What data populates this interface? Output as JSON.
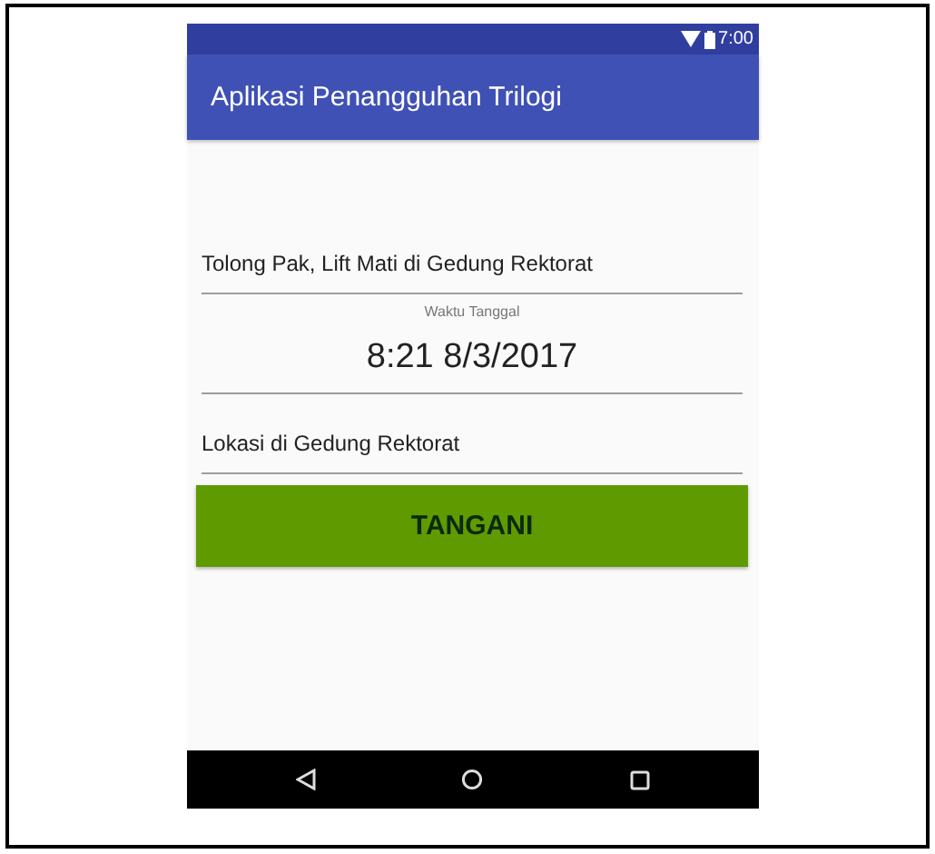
{
  "status_bar": {
    "time": "7:00"
  },
  "app_bar": {
    "title": "Aplikasi Penangguhan Trilogi"
  },
  "fields": [
    {
      "kind": "text",
      "value": "Tolong Pak, Lift Mati di Gedung Rektorat"
    },
    {
      "kind": "labeled",
      "label": "Waktu Tanggal",
      "value": "8:21 8/3/2017"
    },
    {
      "kind": "text",
      "value": "Lokasi di Gedung Rektorat"
    }
  ],
  "button": {
    "label": "TANGANI"
  }
}
